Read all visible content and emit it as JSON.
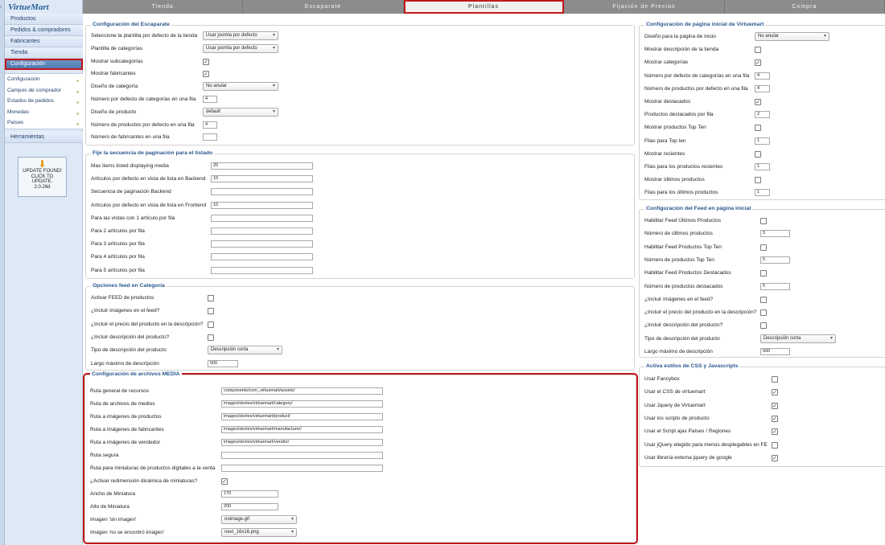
{
  "app": {
    "logo_text": "VirtueMart",
    "collapse_glyph": "‹"
  },
  "sidebar": {
    "main_items": [
      {
        "label": "Productos",
        "active": false
      },
      {
        "label": "Pedidos & compradores",
        "active": false
      },
      {
        "label": "Fabricantes",
        "active": false
      },
      {
        "label": "Tienda",
        "active": false
      },
      {
        "label": "Configuración",
        "active": true
      }
    ],
    "sub_items": [
      {
        "label": "Configuración",
        "icon": "tools-icon"
      },
      {
        "label": "Campos de comprador",
        "icon": "form-icon"
      },
      {
        "label": "Estados de pedidos",
        "icon": "status-icon"
      },
      {
        "label": "Monedas",
        "icon": "coins-icon"
      },
      {
        "label": "Países",
        "icon": "globe-icon"
      }
    ],
    "tools_item": "Herramientas",
    "update": {
      "line1": "UPDATE FOUND!",
      "line2": "CLICK TO",
      "line3": "UPDATE.",
      "version": "2.0.26d"
    }
  },
  "tabs": [
    {
      "label": "Tienda",
      "active": false
    },
    {
      "label": "Escaparate",
      "active": false
    },
    {
      "label": "Plantillas",
      "active": true
    },
    {
      "label": "Fijación de Precios",
      "active": false
    },
    {
      "label": "Compra",
      "active": false
    }
  ],
  "escaparate": {
    "title": "Configuración del Escaparate",
    "rows": [
      {
        "label": "Seleccione la plantilla por defecto de la tienda",
        "type": "select",
        "value": "Usar joomla por defecto"
      },
      {
        "label": "Plantilla de categorías",
        "type": "select",
        "value": "Usar joomla por defecto"
      },
      {
        "label": "Mostrar subcategorías",
        "type": "check",
        "checked": true
      },
      {
        "label": "Mostrar fabricantes",
        "type": "check",
        "checked": true
      },
      {
        "label": "Diseño de categoría",
        "type": "select",
        "value": "No anular"
      },
      {
        "label": "Número por defecto de categorías en una fila",
        "type": "input",
        "value": "4"
      },
      {
        "label": "Diseño de producto",
        "type": "select",
        "value": "default"
      },
      {
        "label": "Número de productos por defecto en una fila",
        "type": "input",
        "value": "4"
      },
      {
        "label": "Número de fabricantes en una fila",
        "type": "input",
        "value": ""
      }
    ]
  },
  "paginacion": {
    "title": "Fije la secuencia de paginación para el listado",
    "rows": [
      {
        "label": "Max items listed displaying media",
        "value": "20"
      },
      {
        "label": "Artículos por defecto en vista de lista en Backend",
        "value": "10"
      },
      {
        "label": "Secuencia de paginación Backend",
        "value": ""
      },
      {
        "label": "Artículos por defecto en vista de lista en Frontend",
        "value": "10"
      },
      {
        "label": "Para las vistas con 1 artículo por fila",
        "value": ""
      },
      {
        "label": "Para 2 artículos por fila",
        "value": ""
      },
      {
        "label": "Para 3 artículos por fila",
        "value": ""
      },
      {
        "label": "Para 4 artículos por fila",
        "value": ""
      },
      {
        "label": "Para 5 artículos por fila",
        "value": ""
      }
    ]
  },
  "feed_categoria": {
    "title": "Opciones feed en Categoría",
    "rows": [
      {
        "label": "Activar FEED de productos",
        "type": "check",
        "checked": false
      },
      {
        "label": "¿Incluir imágenes en el feed?",
        "type": "check",
        "checked": false
      },
      {
        "label": "¿Incluir el precio del producto en la descripción?",
        "type": "check",
        "checked": false
      },
      {
        "label": "¿Incluir descripción del producto?",
        "type": "check",
        "checked": false
      },
      {
        "label": "Tipo de descripción del producto",
        "type": "select",
        "value": "Descripción corta"
      },
      {
        "label": "Largo máximo de descripción",
        "type": "input",
        "value": "500"
      }
    ]
  },
  "media": {
    "title": "Configuración de archivos MEDIA",
    "rows": [
      {
        "label": "Ruta general de recursos",
        "type": "input",
        "value": "components/com_virtuemart/assets/"
      },
      {
        "label": "Ruta de archivos de medios",
        "type": "input",
        "value": "images/stories/virtuemart/category/"
      },
      {
        "label": "Ruta a imágenes de productos",
        "type": "input",
        "value": "images/stories/virtuemart/product/"
      },
      {
        "label": "Ruta a imágenes de fabricantes",
        "type": "input",
        "value": "images/stories/virtuemart/manufacturer/"
      },
      {
        "label": "Ruta a imágenes de vendedor",
        "type": "input",
        "value": "images/stories/virtuemart/vendor/"
      },
      {
        "label": "Ruta segura",
        "type": "input",
        "value": ""
      },
      {
        "label": "Ruta para miniaturas de productos digitales a la venta",
        "type": "input",
        "value": ""
      },
      {
        "label": "¿Activar redimensión dinámica de miniaturas?",
        "type": "check",
        "checked": true
      },
      {
        "label": "Ancho de Miniatura",
        "type": "short",
        "value": "170"
      },
      {
        "label": "Alto de Miniatura",
        "type": "short",
        "value": "200"
      },
      {
        "label": "Imagen 'sin imagen'",
        "type": "select",
        "value": "noimage.gif"
      },
      {
        "label": "Imagen 'no se encontró imagen'",
        "type": "select",
        "value": "next_16x16.png"
      }
    ]
  },
  "inicio": {
    "title": "Configuración de página inicial de Virtuemart",
    "rows": [
      {
        "label": "Diseño para la página de inicio",
        "type": "select",
        "value": "No anular"
      },
      {
        "label": "Mostrar descripción de la tienda",
        "type": "check",
        "checked": false
      },
      {
        "label": "Mostrar categorías",
        "type": "check",
        "checked": true
      },
      {
        "label": "Número por defecto de categorías en una fila",
        "type": "input",
        "value": "4"
      },
      {
        "label": "Número de productos por defecto en una fila",
        "type": "input",
        "value": "4"
      },
      {
        "label": "Mostrar destacados",
        "type": "check",
        "checked": true
      },
      {
        "label": "Productos destacados por fila",
        "type": "input",
        "value": "2"
      },
      {
        "label": "Mostrar productos Top Ten",
        "type": "check",
        "checked": false
      },
      {
        "label": "Filas para Top ten",
        "type": "input",
        "value": "1"
      },
      {
        "label": "Mostrar recientes",
        "type": "check",
        "checked": false
      },
      {
        "label": "Filas para los productos recientes",
        "type": "input",
        "value": "1"
      },
      {
        "label": "Mostrar últimos productos",
        "type": "check",
        "checked": false
      },
      {
        "label": "Filas para los últimos productos",
        "type": "input",
        "value": "1"
      }
    ]
  },
  "feed_inicio": {
    "title": "Configuración del Feed en página inicial",
    "rows": [
      {
        "label": "Habilitar Feed Últimos Productos",
        "type": "check",
        "checked": false
      },
      {
        "label": "Número de últimos productos",
        "type": "input",
        "value": "5"
      },
      {
        "label": "Habilitar Feed Productos Top Ten",
        "type": "check",
        "checked": false
      },
      {
        "label": "Número de productos Top Ten",
        "type": "input",
        "value": "5"
      },
      {
        "label": "Habilitar Feed Productos Destacados",
        "type": "check",
        "checked": false
      },
      {
        "label": "Número de productos destacados",
        "type": "input",
        "value": "5"
      },
      {
        "label": "¿Incluir imágenes en el feed?",
        "type": "check",
        "checked": false
      },
      {
        "label": "¿Incluir el precio del producto en la descripción?",
        "type": "check",
        "checked": false
      },
      {
        "label": "¿Incluir descripción del producto?",
        "type": "check",
        "checked": false
      },
      {
        "label": "Tipo de descripción del producto",
        "type": "select",
        "value": "Descripción corta"
      },
      {
        "label": "Largo máximo de descripción",
        "type": "input",
        "value": "500"
      }
    ]
  },
  "css_js": {
    "title": "Activa estilos de CSS y Javascripts",
    "rows": [
      {
        "label": "Usar Fancybox",
        "type": "check",
        "checked": false
      },
      {
        "label": "Usar el CSS de virtuemart",
        "type": "check",
        "checked": true
      },
      {
        "label": "Usar Jquery de Virtuemart",
        "type": "check",
        "checked": true
      },
      {
        "label": "Usar los scripts de producto",
        "type": "check",
        "checked": true
      },
      {
        "label": "Usar el Script ajax Países / Regiones",
        "type": "check",
        "checked": true
      },
      {
        "label": "Usar jQuery elegido para menús desplegables en FE",
        "type": "check",
        "checked": false
      },
      {
        "label": "Usar librería externa jquery de google",
        "type": "check",
        "checked": true
      }
    ]
  },
  "glyphs": {
    "check": "✓",
    "caret": "▾",
    "update_arrow": "⬇"
  }
}
